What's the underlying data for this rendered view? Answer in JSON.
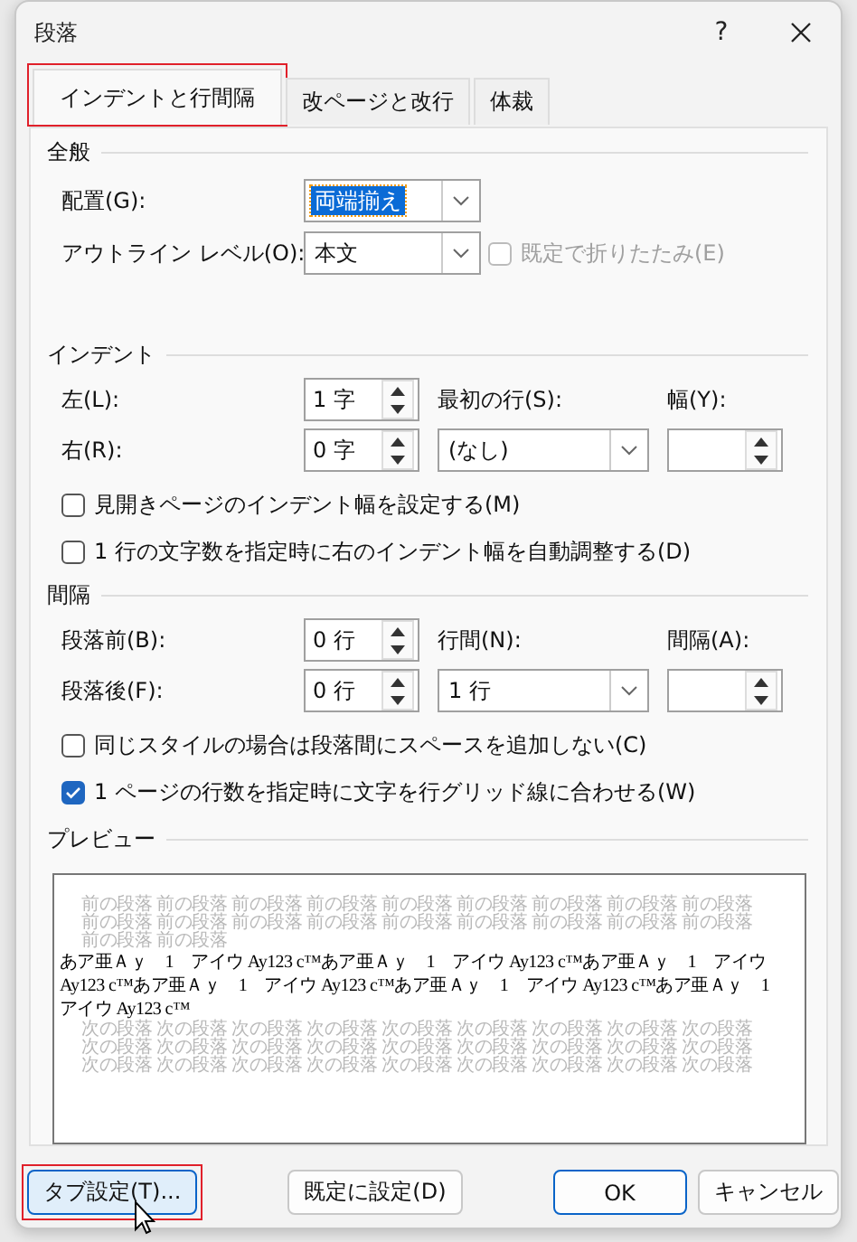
{
  "window": {
    "title": "段落",
    "help": "?"
  },
  "tabs": [
    {
      "label": "インデントと行間隔",
      "selected": true,
      "highlighted": true
    },
    {
      "label": "改ページと改行",
      "selected": false,
      "highlighted": false
    },
    {
      "label": "体裁",
      "selected": false,
      "highlighted": false
    }
  ],
  "general": {
    "heading": "全般",
    "alignment": {
      "label": "配置(G):",
      "value": "両端揃え",
      "focused": true
    },
    "outline_level": {
      "label": "アウトライン レベル(O):",
      "value": "本文",
      "focused": false
    },
    "collapse": {
      "label": "既定で折りたたみ(E)",
      "checked": false,
      "disabled": true
    }
  },
  "indent": {
    "heading": "インデント",
    "left": {
      "label": "左(L):",
      "value": "1 字"
    },
    "right": {
      "label": "右(R):",
      "value": "0 字"
    },
    "first_line": {
      "label": "最初の行(S):",
      "value": "(なし)",
      "focused": false
    },
    "by": {
      "label": "幅(Y):"
    },
    "options": [
      {
        "label": "見開きページのインデント幅を設定する(M)",
        "checked": false,
        "disabled": false
      },
      {
        "label": "1 行の文字数を指定時に右のインデント幅を自動調整する(D)",
        "checked": false,
        "disabled": false
      }
    ]
  },
  "spacing": {
    "heading": "間隔",
    "before": {
      "label": "段落前(B):",
      "value": "0 行"
    },
    "after": {
      "label": "段落後(F):",
      "value": "0 行"
    },
    "line_spacing": {
      "label": "行間(N):",
      "value": "1 行",
      "focused": false
    },
    "at": {
      "label": "間隔(A):"
    },
    "options": [
      {
        "label": "同じスタイルの場合は段落間にスペースを追加しない(C)",
        "checked": false,
        "disabled": false
      },
      {
        "label": "1 ページの行数を指定時に文字を行グリッド線に合わせる(W)",
        "checked": true,
        "disabled": false
      }
    ]
  },
  "preview": {
    "heading": "プレビュー",
    "lines": [
      {
        "kind": "previous",
        "text": "前の段落 前の段落 前の段落 前の段落 前の段落 前の段落 前の段落 前の段落 前の段落"
      },
      {
        "kind": "previous",
        "text": "前の段落 前の段落 前の段落 前の段落 前の段落 前の段落 前の段落 前の段落 前の段落"
      },
      {
        "kind": "previous",
        "text": "前の段落 前の段落"
      },
      {
        "kind": "current",
        "text": "あア亜Ａｙ　1　アイウ Ay123 c™あア亜Ａｙ　1　アイウ Ay123 c™あア亜Ａｙ　1　アイウ"
      },
      {
        "kind": "current",
        "text": "Ay123 c™あア亜Ａｙ　1　アイウ Ay123 c™あア亜Ａｙ　1　アイウ Ay123 c™あア亜Ａｙ　1"
      },
      {
        "kind": "current",
        "text": "アイウ Ay123 c™"
      },
      {
        "kind": "next",
        "text": "次の段落 次の段落 次の段落 次の段落 次の段落 次の段落 次の段落 次の段落 次の段落"
      },
      {
        "kind": "next",
        "text": "次の段落 次の段落 次の段落 次の段落 次の段落 次の段落 次の段落 次の段落 次の段落"
      },
      {
        "kind": "next",
        "text": "次の段落 次の段落 次の段落 次の段落 次の段落 次の段落 次の段落 次の段落 次の段落"
      }
    ]
  },
  "buttons": [
    {
      "label": "タブ設定(T)...",
      "default": false,
      "hovered": true,
      "highlighted": true
    },
    {
      "label": "既定に設定(D)",
      "default": false,
      "hovered": false,
      "highlighted": false
    },
    {
      "label": "OK",
      "default": true,
      "hovered": false,
      "highlighted": false
    },
    {
      "label": "キャンセル",
      "default": false,
      "hovered": false,
      "highlighted": false
    }
  ]
}
